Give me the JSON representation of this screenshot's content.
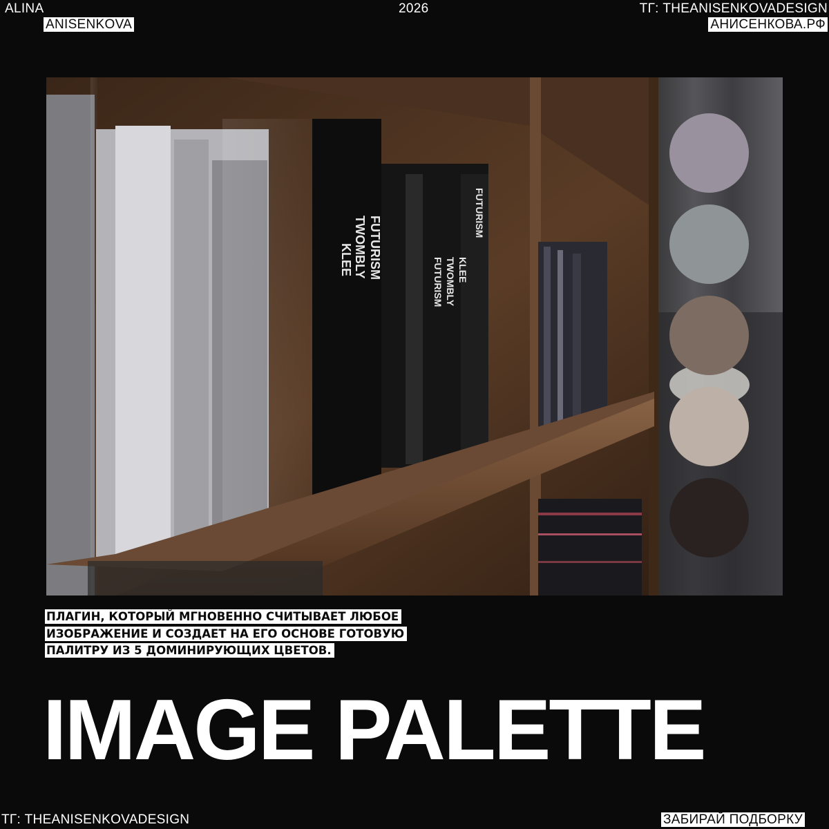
{
  "header": {
    "author_first": "ALINA",
    "author_last": "ANISENKOVA",
    "year": "2026",
    "telegram": "ТГ: THEANISENKOVADESIGN",
    "site": "АНИСЕНКОВА.РФ"
  },
  "photo": {
    "book_titles": [
      "FUTURISM",
      "TWOMBLY",
      "KLEE",
      "FUTURISM",
      "TWOMBLY",
      "KLEE",
      "FUTURISM"
    ]
  },
  "palette": {
    "colors": [
      "#9a919f",
      "#8f9597",
      "#7d6c62",
      "#bdb0a6",
      "#2a2220"
    ]
  },
  "description": "ПЛАГИН, КОТОРЫЙ МГНОВЕННО СЧИТЫВАЕТ ЛЮБОЕ ИЗОБРАЖЕНИЕ И СОЗДАЕТ НА ЕГО ОСНОВЕ ГОТОВУЮ ПАЛИТРУ ИЗ 5 ДОМИНИРУЮЩИХ ЦВЕТОВ.",
  "title": "IMAGE PALETTE",
  "footer": {
    "telegram": "ТГ: THEANISENKOVADESIGN",
    "cta": "ЗАБИРАЙ ПОДБОРКУ"
  }
}
